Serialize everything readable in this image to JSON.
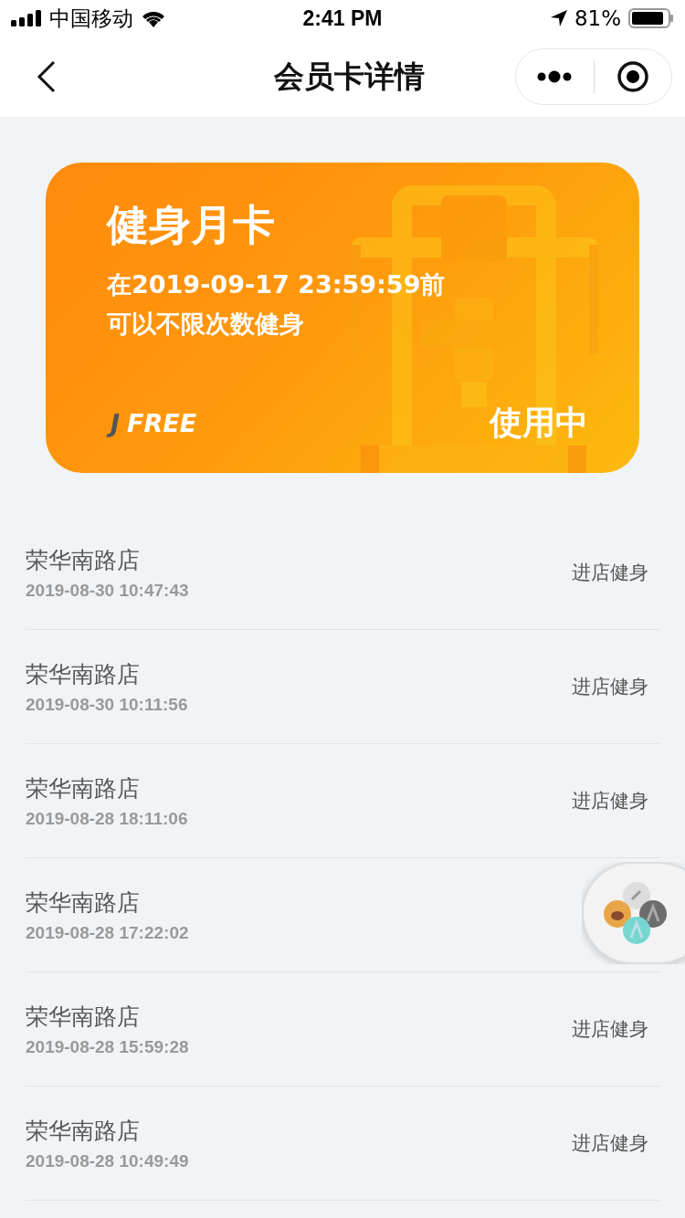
{
  "status_bar": {
    "carrier": "中国移动",
    "time": "2:41 PM",
    "battery": "81%"
  },
  "nav": {
    "title": "会员卡详情"
  },
  "card": {
    "name": "健身月卡",
    "validity": "在2019-09-17 23:59:59前",
    "description": "可以不限次数健身",
    "brand_mark": "J",
    "brand_name": "FREE",
    "status": "使用中"
  },
  "records": [
    {
      "store": "荣华南路店",
      "time": "2019-08-30 10:47:43",
      "action": "进店健身"
    },
    {
      "store": "荣华南路店",
      "time": "2019-08-30 10:11:56",
      "action": "进店健身"
    },
    {
      "store": "荣华南路店",
      "time": "2019-08-28 18:11:06",
      "action": "进店健身"
    },
    {
      "store": "荣华南路店",
      "time": "2019-08-28 17:22:02"
    },
    {
      "store": "荣华南路店",
      "time": "2019-08-28 15:59:28",
      "action": "进店健身"
    },
    {
      "store": "荣华南路店",
      "time": "2019-08-28 10:49:49",
      "action": "进店健身"
    }
  ]
}
